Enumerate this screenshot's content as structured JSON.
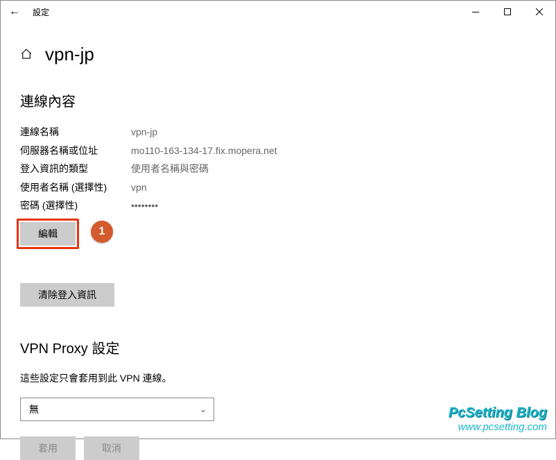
{
  "window": {
    "title": "設定"
  },
  "page": {
    "title": "vpn-jp"
  },
  "section_connection": {
    "heading": "連線內容",
    "rows": {
      "name_label": "連線名稱",
      "name_value": "vpn-jp",
      "server_label": "伺服器名稱或位址",
      "server_value": "mo110-163-134-17.fix.mopera.net",
      "auth_label": "登入資訊的類型",
      "auth_value": "使用者名稱與密碼",
      "user_label": "使用者名稱 (選擇性)",
      "user_value": "vpn",
      "pass_label": "密碼 (選擇性)",
      "pass_value": "••••••••"
    },
    "edit_button": "編輯",
    "clear_button": "清除登入資訊"
  },
  "section_proxy": {
    "heading": "VPN Proxy 設定",
    "description": "這些設定只會套用到此 VPN 連線。",
    "select_value": "無"
  },
  "bottom": {
    "apply": "套用",
    "cancel": "取消"
  },
  "callout": {
    "number": "1"
  },
  "watermark": {
    "line1": "PcSetting Blog",
    "line2": "www.pcsetting.com"
  }
}
